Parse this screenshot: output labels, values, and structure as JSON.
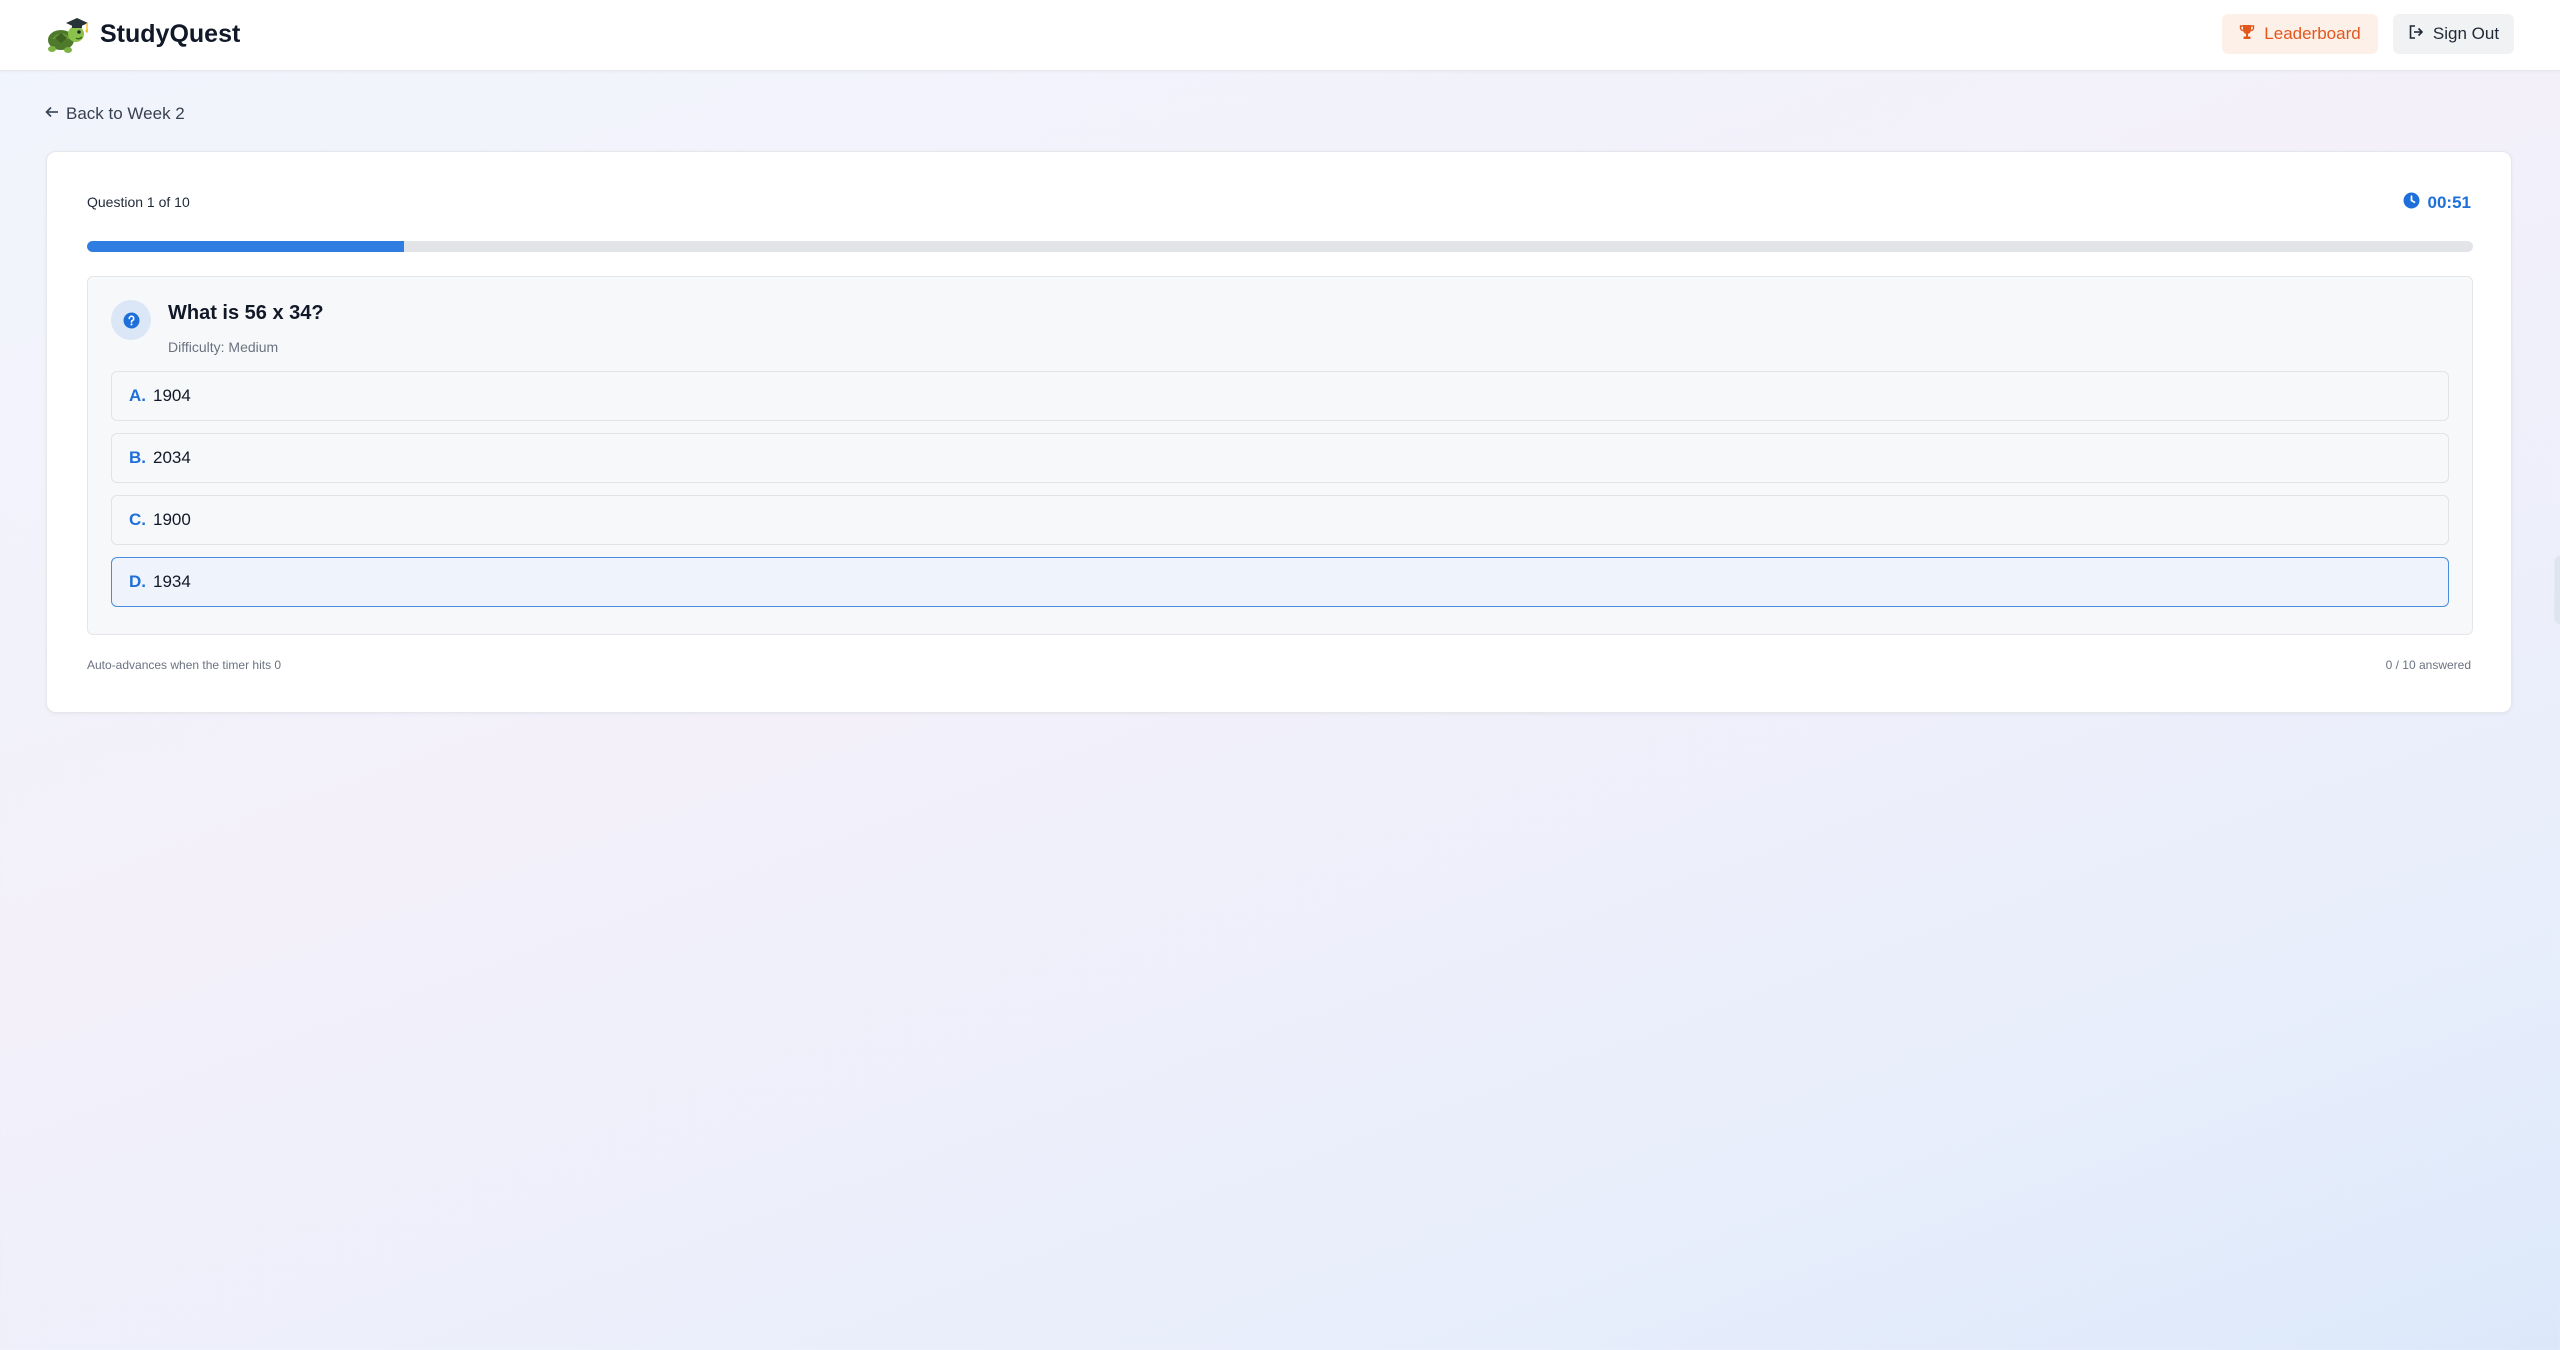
{
  "app": {
    "name": "StudyQuest",
    "logo_icon": "turtle-graduate-icon"
  },
  "header": {
    "leaderboard_label": "Leaderboard",
    "leaderboard_icon": "trophy-icon",
    "signout_label": "Sign Out",
    "signout_icon": "sign-out-icon"
  },
  "nav": {
    "back_label": "Back to Week 2",
    "back_icon": "arrow-left-icon"
  },
  "quiz": {
    "counter": "Question 1 of 10",
    "timer": "00:51",
    "timer_icon": "clock-icon",
    "progress": 0.133,
    "question": "What is 56 x 34?",
    "difficulty": "Difficulty: Medium",
    "question_icon": "question-circle-icon",
    "options": [
      {
        "letter": "A.",
        "text": "1904",
        "selected": false
      },
      {
        "letter": "B.",
        "text": "2034",
        "selected": false
      },
      {
        "letter": "C.",
        "text": "1900",
        "selected": false
      },
      {
        "letter": "D.",
        "text": "1934",
        "selected": true
      }
    ],
    "footer_note": "Auto-advances when the timer hits 0",
    "answered": "0 / 10 answered"
  },
  "colors": {
    "accent": "#1e6fd9",
    "progress": "#2f7de1",
    "leaderboard": "#e2571d",
    "leaderboard_bg": "#fdf0e8"
  }
}
